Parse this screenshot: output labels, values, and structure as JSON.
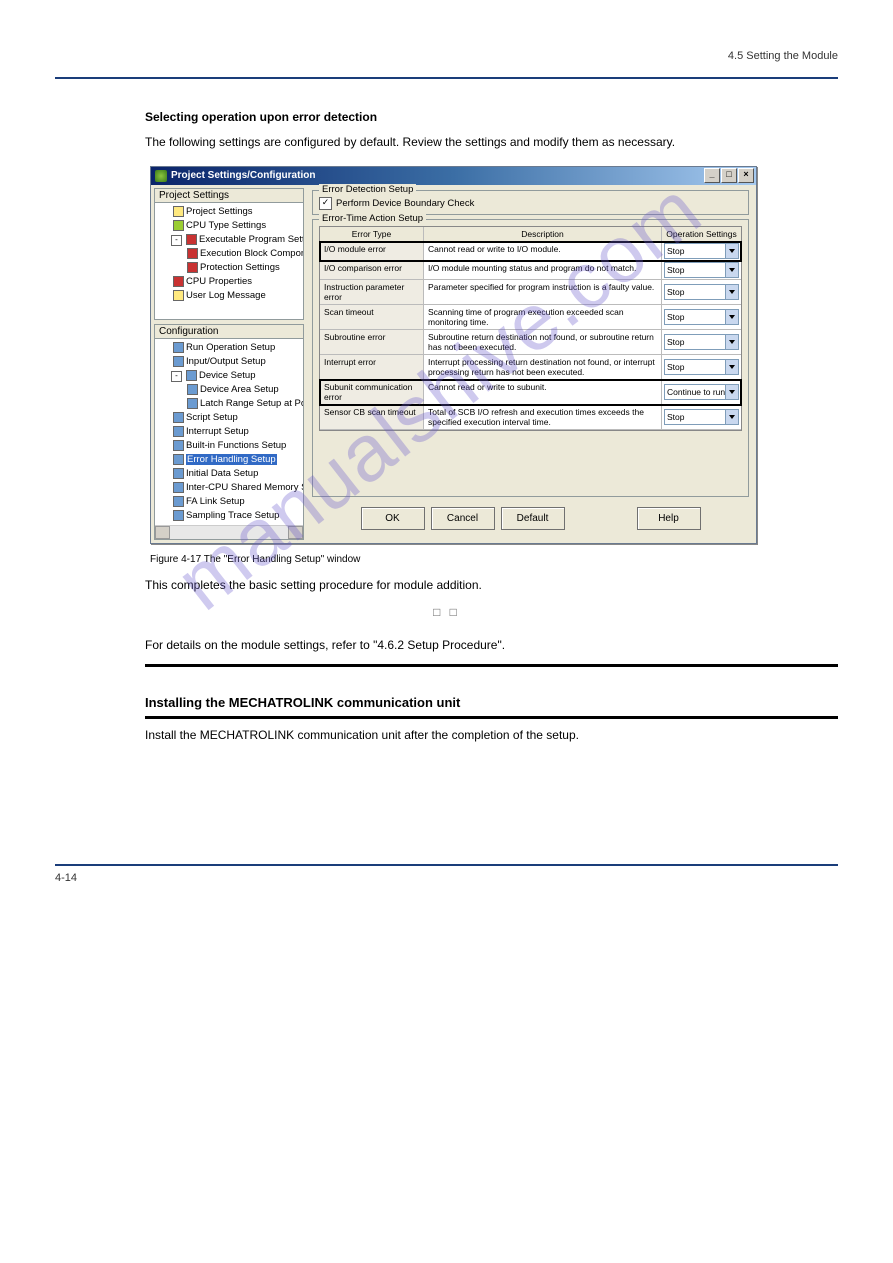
{
  "header": {
    "right": "4.5 Setting the Module"
  },
  "intro_bold": "Selecting operation upon error detection",
  "intro_text": "The following settings are configured by default. Review the settings and modify them as necessary.",
  "watermark": "manualshive.com",
  "dialog": {
    "title": "Project Settings/Configuration",
    "panes": {
      "project": "Project Settings",
      "config": "Configuration"
    },
    "tree_top": [
      {
        "lvl": 1,
        "ico": "y",
        "label": "Project Settings"
      },
      {
        "lvl": 1,
        "ico": "g",
        "label": "CPU Type Settings"
      },
      {
        "lvl": 1,
        "ico": "r",
        "label": "Executable Program Settings",
        "exp": "-"
      },
      {
        "lvl": 2,
        "ico": "r",
        "label": "Execution Block Components"
      },
      {
        "lvl": 2,
        "ico": "r",
        "label": "Protection Settings"
      },
      {
        "lvl": 1,
        "ico": "r",
        "label": "CPU Properties"
      },
      {
        "lvl": 1,
        "ico": "y",
        "label": "User Log Message"
      }
    ],
    "tree_bot": [
      {
        "lvl": 1,
        "ico": "b",
        "label": "Run Operation Setup"
      },
      {
        "lvl": 1,
        "ico": "b",
        "label": "Input/Output Setup"
      },
      {
        "lvl": 1,
        "ico": "b",
        "label": "Device Setup",
        "exp": "-"
      },
      {
        "lvl": 2,
        "ico": "b",
        "label": "Device Area Setup"
      },
      {
        "lvl": 2,
        "ico": "b",
        "label": "Latch Range Setup at Power"
      },
      {
        "lvl": 1,
        "ico": "b",
        "label": "Script Setup"
      },
      {
        "lvl": 1,
        "ico": "b",
        "label": "Interrupt Setup"
      },
      {
        "lvl": 1,
        "ico": "b",
        "label": "Built-in Functions Setup"
      },
      {
        "lvl": 1,
        "ico": "b",
        "label": "Error Handling Setup",
        "sel": true
      },
      {
        "lvl": 1,
        "ico": "b",
        "label": "Initial Data Setup"
      },
      {
        "lvl": 1,
        "ico": "b",
        "label": "Inter-CPU Shared Memory Setup"
      },
      {
        "lvl": 1,
        "ico": "b",
        "label": "FA Link Setup"
      },
      {
        "lvl": 1,
        "ico": "b",
        "label": "Sampling Trace Setup"
      }
    ],
    "group_detect": {
      "title": "Error Detection Setup",
      "checkbox": "Perform Device Boundary Check",
      "checked": true
    },
    "group_action": {
      "title": "Error-Time Action Setup"
    },
    "grid": {
      "head": {
        "c1": "Error Type",
        "c2": "Description",
        "c3": "Operation Settings"
      },
      "rows": [
        {
          "c1": "I/O module error",
          "c2": "Cannot read or write to I/O module.",
          "c3": "Stop",
          "hl": true
        },
        {
          "c1": "I/O comparison error",
          "c2": "I/O module mounting status and program do not match.",
          "c3": "Stop"
        },
        {
          "c1": "Instruction parameter error",
          "c2": "Parameter specified for program instruction is a faulty value.",
          "c3": "Stop"
        },
        {
          "c1": "Scan timeout",
          "c2": "Scanning time of program execution exceeded scan monitoring time.",
          "c3": "Stop"
        },
        {
          "c1": "Subroutine error",
          "c2": "Subroutine return destination not found, or subroutine return has not been executed.",
          "c3": "Stop"
        },
        {
          "c1": "Interrupt error",
          "c2": "Interrupt processing return destination not found, or interrupt processing return has not been executed.",
          "c3": "Stop"
        },
        {
          "c1": "Subunit communication error",
          "c2": "Cannot read or write to subunit.",
          "c3": "Continue to run",
          "hl": true
        },
        {
          "c1": "Sensor CB scan timeout",
          "c2": "Total of SCB I/O refresh and execution times exceeds the specified execution interval time.",
          "c3": "Stop"
        }
      ]
    },
    "buttons": {
      "ok": "OK",
      "cancel": "Cancel",
      "def": "Default",
      "help": "Help"
    }
  },
  "fig_caption": "Figure 4-17   The \"Error Handling Setup\" window",
  "after_fig1": "This completes the basic setting procedure for module addition.",
  "after_fig2": "For details on the module settings, refer to     \"4.6.2 Setup Procedure\".",
  "section_title": "Installing the MECHATROLINK communication unit",
  "section_body": "Install the MECHATROLINK communication unit after the completion of the setup.",
  "footer": {
    "page": "4-14"
  }
}
